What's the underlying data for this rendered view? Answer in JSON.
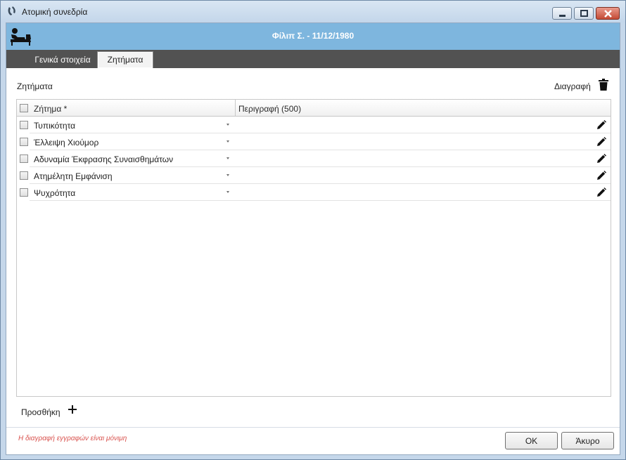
{
  "window": {
    "title": "Ατομική συνεδρία",
    "close_color": "#c44b35"
  },
  "header": {
    "patient": "Φίλιπ Σ. - 11/12/1980",
    "band_color": "#7eb6de"
  },
  "tabs": [
    {
      "label": "Γενικά στοιχεία",
      "active": false
    },
    {
      "label": "Ζητήματα",
      "active": true
    }
  ],
  "issues": {
    "section_title": "Ζητήματα",
    "delete_label": "Διαγραφή",
    "columns": [
      "Ζήτημα *",
      "Περιγραφή (500)"
    ],
    "rows": [
      {
        "issue": "Τυπικότητα",
        "description": ""
      },
      {
        "issue": "Έλλειψη Χιούμορ",
        "description": ""
      },
      {
        "issue": "Αδυναμία Έκφρασης Συναισθημάτων",
        "description": ""
      },
      {
        "issue": "Ατημέλητη Εμφάνιση",
        "description": ""
      },
      {
        "issue": "Ψυχρότητα",
        "description": ""
      }
    ],
    "add_label": "Προσθήκη"
  },
  "footer": {
    "warning": "Η διαγραφή εγγραφών είναι μόνιμη",
    "warning_color": "#d9534f",
    "ok_label": "OK",
    "cancel_label": "Άκυρο"
  },
  "icons": {
    "app": "couch-patient-icon",
    "trash": "trash-icon",
    "edit": "pencil-icon",
    "add": "plus-icon"
  }
}
